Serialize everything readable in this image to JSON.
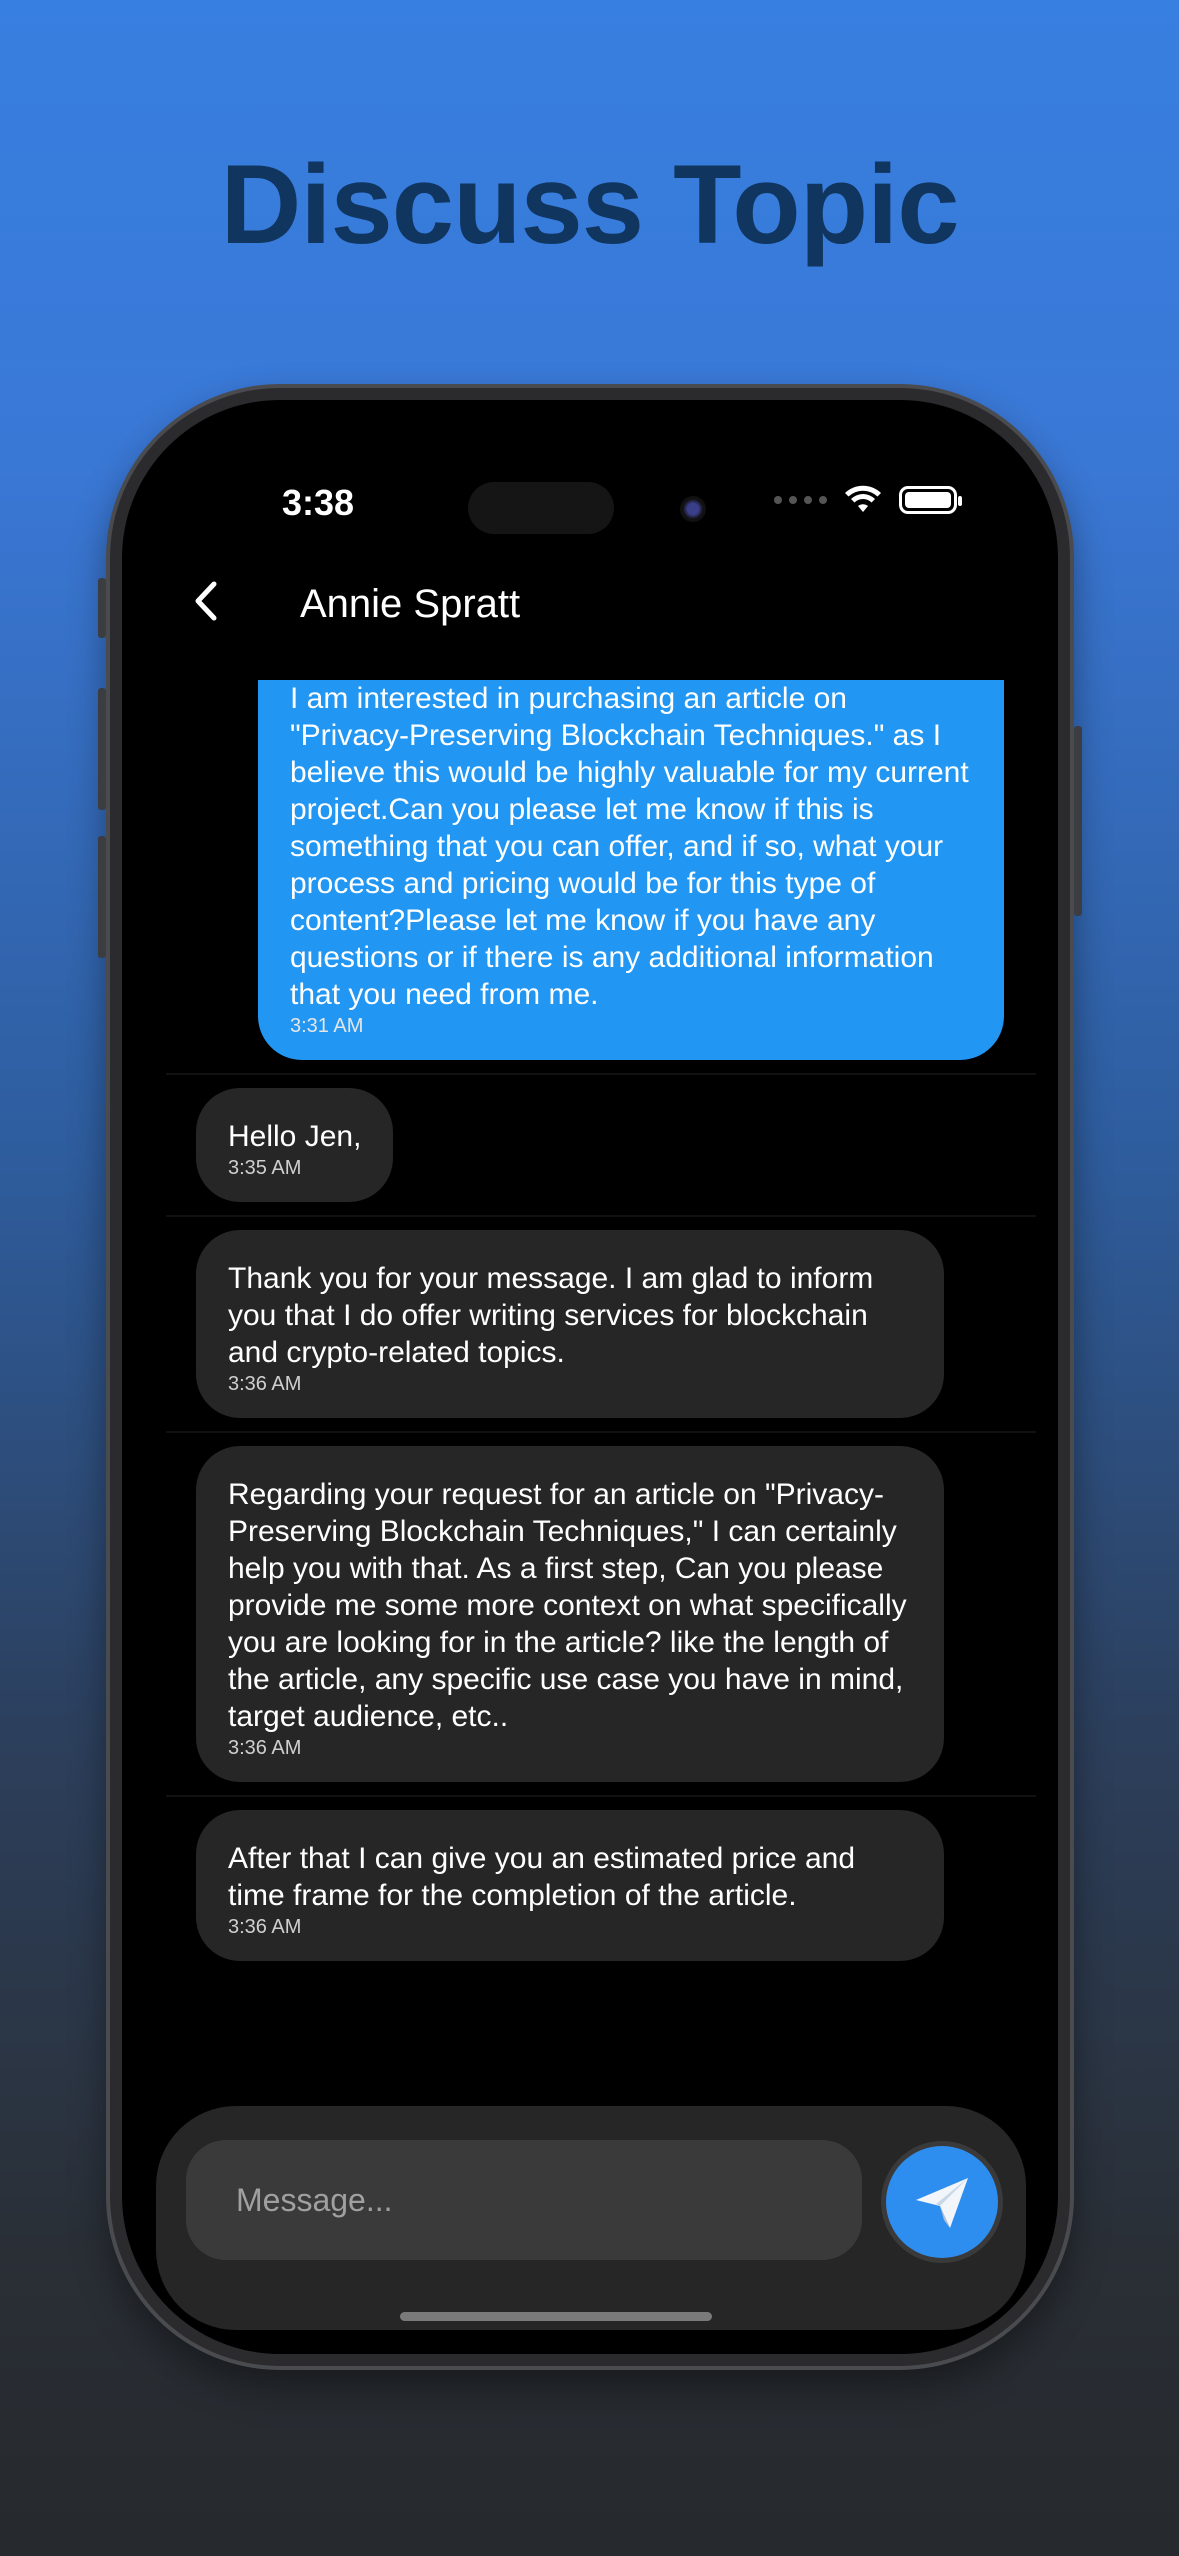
{
  "headline": "Discuss Topic",
  "status": {
    "time": "3:38"
  },
  "header": {
    "title": "Annie Spratt"
  },
  "messages": [
    {
      "direction": "out",
      "text": "I am interested in purchasing an article on \"Privacy-Preserving Blockchain Techniques.\" as I believe this would be highly valuable for my current project.Can you please let me know if this is something that you can offer, and if so, what your process and pricing would be for this type of content?Please let me know if you have any questions or if there is any additional information that you need from me.",
      "time": "3:31 AM"
    },
    {
      "direction": "in",
      "text": "Hello Jen,",
      "time": "3:35 AM"
    },
    {
      "direction": "in",
      "text": "Thank you for your message. I am glad to inform you that I do offer writing services for blockchain and crypto-related topics.",
      "time": "3:36 AM"
    },
    {
      "direction": "in",
      "text": "Regarding your request for an article on \"Privacy-Preserving Blockchain Techniques,\" I can certainly help you with that. As a first step, Can you please provide me some more context on what specifically you are looking for in the article? like the length of the article, any specific use case you have in mind, target audience, etc..",
      "time": "3:36 AM"
    },
    {
      "direction": "in",
      "text": "After that I can give you an estimated price and time frame for the completion of the article.",
      "time": "3:36 AM"
    }
  ],
  "composer": {
    "placeholder": "Message..."
  },
  "colors": {
    "background_top": "#377fe0",
    "accent": "#2196f3",
    "incoming_bubble": "#262626",
    "headline": "#10355f"
  },
  "icons": {
    "back": "chevron-left-icon",
    "send": "paper-plane-icon",
    "wifi": "wifi-icon",
    "battery": "battery-icon"
  }
}
